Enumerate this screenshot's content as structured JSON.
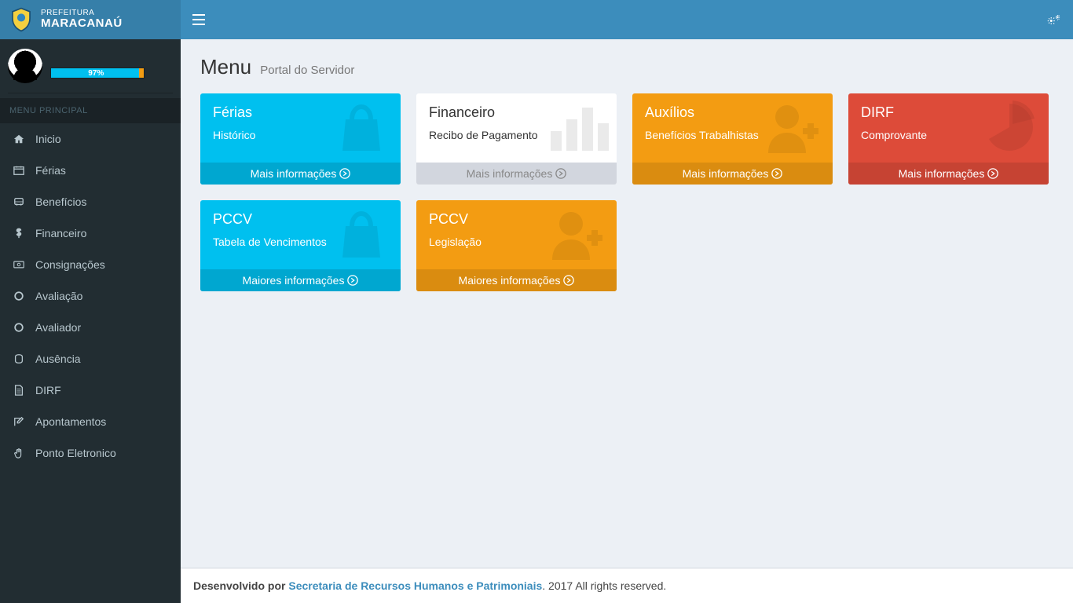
{
  "brand": {
    "line1": "PREFEITURA",
    "line2": "MARACANAÚ"
  },
  "user": {
    "name": "",
    "progress_pct": 97,
    "progress_label": "97%"
  },
  "sidebar": {
    "header": "MENU PRINCIPAL",
    "items": [
      {
        "icon": "home-icon",
        "label": "Inicio"
      },
      {
        "icon": "calendar-icon",
        "label": "Férias"
      },
      {
        "icon": "bus-icon",
        "label": "Benefícios"
      },
      {
        "icon": "dollar-icon",
        "label": "Financeiro"
      },
      {
        "icon": "money-icon",
        "label": "Consignações"
      },
      {
        "icon": "circle-icon",
        "label": "Avaliação"
      },
      {
        "icon": "circle-icon",
        "label": "Avaliador"
      },
      {
        "icon": "absence-icon",
        "label": "Ausência"
      },
      {
        "icon": "file-icon",
        "label": "DIRF"
      },
      {
        "icon": "edit-icon",
        "label": "Apontamentos"
      },
      {
        "icon": "hand-icon",
        "label": "Ponto Eletronico"
      }
    ]
  },
  "page": {
    "title": "Menu",
    "subtitle": "Portal do Servidor"
  },
  "tiles": [
    {
      "color": "aqua",
      "title": "Férias",
      "subtitle": "Histórico",
      "footer": "Mais informações",
      "icon": "bag"
    },
    {
      "color": "gray",
      "title": "Financeiro",
      "subtitle": "Recibo de Pagamento",
      "footer": "Mais informações",
      "icon": "bars"
    },
    {
      "color": "orange",
      "title": "Auxílios",
      "subtitle": "Benefícios Trabalhistas",
      "footer": "Mais informações",
      "icon": "user"
    },
    {
      "color": "red",
      "title": "DIRF",
      "subtitle": "Comprovante",
      "footer": "Mais informações",
      "icon": "pie"
    },
    {
      "color": "aqua",
      "title": "PCCV",
      "subtitle": "Tabela de Vencimentos",
      "footer": "Maiores informações",
      "icon": "bag"
    },
    {
      "color": "orange",
      "title": "PCCV",
      "subtitle": "Legislação",
      "footer": "Maiores informações",
      "icon": "user"
    }
  ],
  "footer": {
    "prefix": "Desenvolvido por ",
    "link": "Secretaria de Recursos Humanos e Patrimoniais",
    "suffix": ". 2017 All rights reserved."
  },
  "topbar": {
    "username": ""
  }
}
